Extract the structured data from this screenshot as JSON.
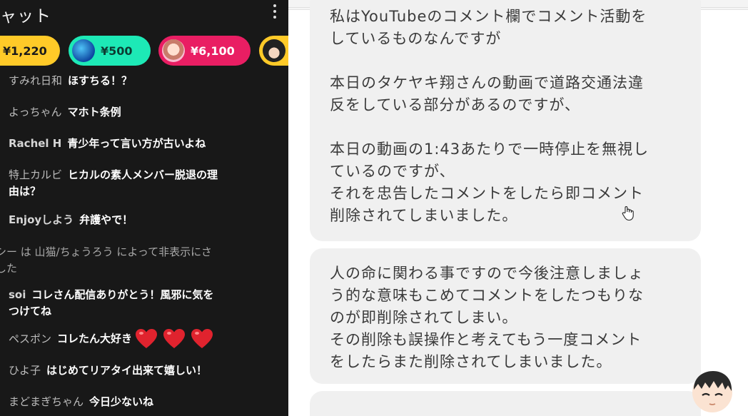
{
  "chat": {
    "title": "ャット",
    "more_icon": "more-vert-icon",
    "ticker": [
      {
        "amount": "¥1,220",
        "color": "#ffca28"
      },
      {
        "amount": "¥500",
        "color": "#1de9b6"
      },
      {
        "amount": "¥6,100",
        "color": "#e91e63"
      },
      {
        "amount": "",
        "color": "#ffca28"
      }
    ],
    "messages": [
      {
        "author": "すみれ日和",
        "text": "ほすちる！？"
      },
      {
        "author": "よっちゃん",
        "text": "マホト条例"
      },
      {
        "author": "Rachel H",
        "text": "青少年って言い方が古いよね"
      },
      {
        "author": "特上カルビ",
        "text": "ヒカルの素人メンバー脱退の理",
        "text_line2": "由は？"
      },
      {
        "author": "Enjoyしよう",
        "text": "弁護やで！"
      },
      {
        "system_line1": "シー は 山猫/ちょうろう によって非表示にさ",
        "system_line2": "した"
      },
      {
        "author": "soi",
        "text": "コレさん配信ありがとう！風邪に気を",
        "text_line2": "つけてね"
      },
      {
        "author": "ペスポン",
        "text": "コレたん大好き",
        "hearts": 3
      },
      {
        "author": "ひよ子",
        "text": "はじめてリアタイ出来て嬉しい！"
      },
      {
        "author": "まどまぎちゃん",
        "text": "今日少ないね"
      }
    ]
  },
  "thread": {
    "bubble1": {
      "p1": "私はYouTubeのコメント欄でコメント活動を\nしているものなんですが",
      "p2": "本日のタケヤキ翔さんの動画で道路交通法違\n反をしている部分があるのですが、",
      "p3": "本日の動画の1:43あたりで一時停止を無視し\nているのですが、\nそれを忠告したコメントをしたら即コメント\n削除されてしまいました。"
    },
    "bubble2": {
      "p1": "人の命に関わる事ですので今後注意しましょ\nう的な意味もこめてコメントをしたつもりな\nのが即削除されてしまい。\nその削除も誤操作と考えてもう一度コメント\nをしたらまた削除されてしまいました。"
    },
    "cursor_icon": "hand-cursor-icon",
    "avatar_icon": "streamer-avatar-icon",
    "bubble_color": "#f0f0f0"
  }
}
